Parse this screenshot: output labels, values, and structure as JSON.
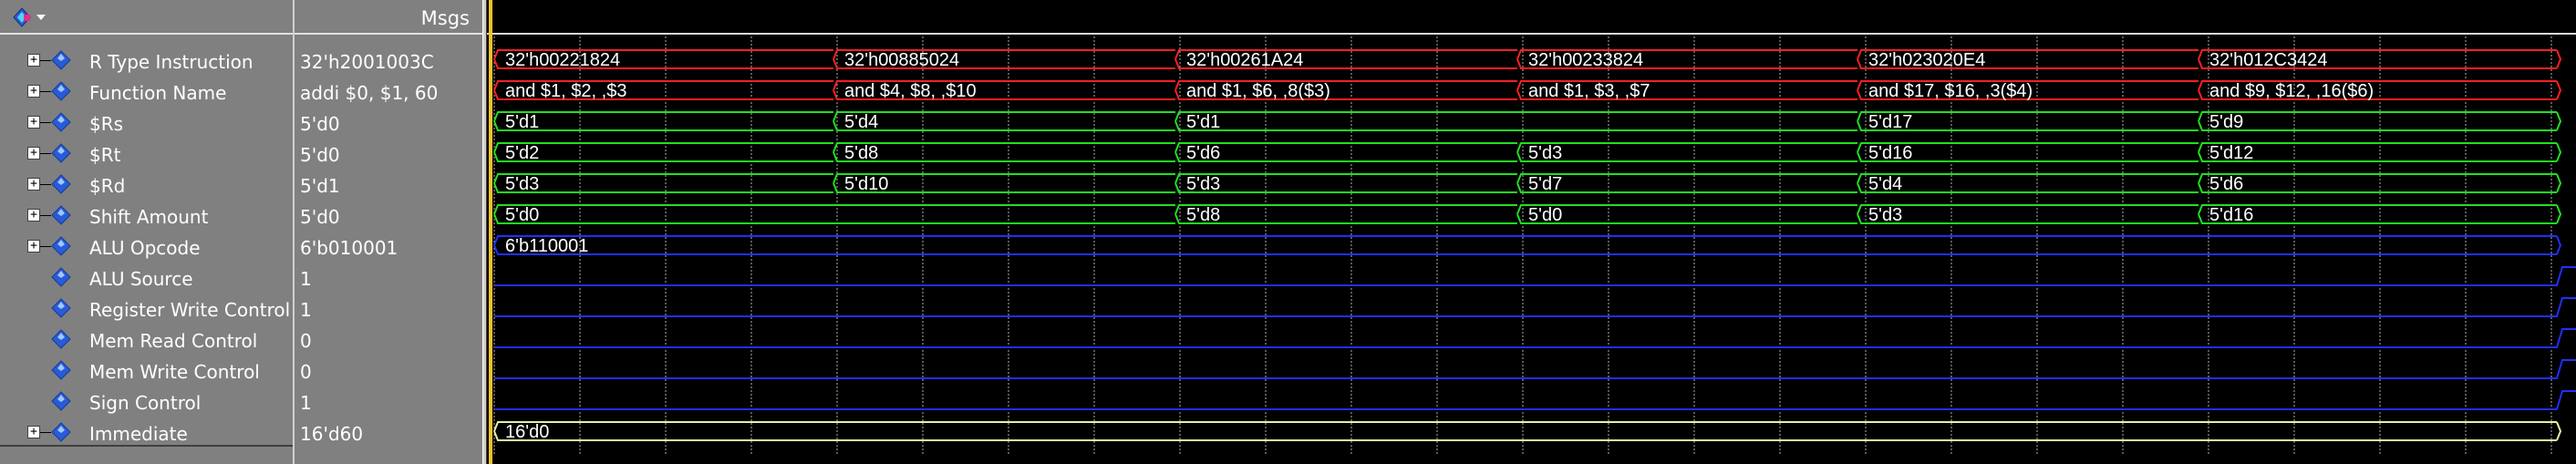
{
  "header": {
    "msgs_label": "Msgs"
  },
  "signals": [
    {
      "name": "R Type Instruction",
      "value": "32'h2001003C",
      "expandable": true
    },
    {
      "name": "Function Name",
      "value": "addi $0, $1, 60",
      "expandable": true
    },
    {
      "name": "$Rs",
      "value": "5'd0",
      "expandable": true
    },
    {
      "name": "$Rt",
      "value": "5'd0",
      "expandable": true
    },
    {
      "name": "$Rd",
      "value": "5'd1",
      "expandable": true
    },
    {
      "name": "Shift Amount",
      "value": "5'd0",
      "expandable": true
    },
    {
      "name": "ALU Opcode",
      "value": "6'b010001",
      "expandable": true
    },
    {
      "name": "ALU Source",
      "value": "1",
      "expandable": false
    },
    {
      "name": "Register Write Control",
      "value": "1",
      "expandable": false
    },
    {
      "name": "Mem Read Control",
      "value": "0",
      "expandable": false
    },
    {
      "name": "Mem Write Control",
      "value": "0",
      "expandable": false
    },
    {
      "name": "Sign Control",
      "value": "1",
      "expandable": false
    },
    {
      "name": "Immediate",
      "value": "16'd60",
      "expandable": true
    }
  ],
  "waveforms": [
    {
      "signal": "R Type Instruction",
      "color": "#ff2020",
      "kind": "bus",
      "segments": [
        "32'h00221824",
        "32'h00885024",
        "32'h00261A24",
        "32'h00233824",
        "32'h023020E4",
        "32'h012C3424"
      ]
    },
    {
      "signal": "Function Name",
      "color": "#ff2020",
      "kind": "bus",
      "segments": [
        "and $1, $2, ,$3",
        "and $4, $8, ,$10",
        "and $1, $6, ,8($3)",
        "and $1, $3, ,$7",
        "and $17, $16, ,3($4)",
        "and $9, $12, ,16($6)"
      ]
    },
    {
      "signal": "$Rs",
      "color": "#20e020",
      "kind": "bus",
      "segments": [
        "5'd1",
        "5'd4",
        "5'd1",
        "",
        "5'd17",
        "5'd9"
      ]
    },
    {
      "signal": "$Rt",
      "color": "#20e020",
      "kind": "bus",
      "segments": [
        "5'd2",
        "5'd8",
        "5'd6",
        "5'd3",
        "5'd16",
        "5'd12"
      ]
    },
    {
      "signal": "$Rd",
      "color": "#20e020",
      "kind": "bus",
      "segments": [
        "5'd3",
        "5'd10",
        "5'd3",
        "5'd7",
        "5'd4",
        "5'd6"
      ]
    },
    {
      "signal": "Shift Amount",
      "color": "#20e020",
      "kind": "bus",
      "segments": [
        "5'd0",
        "",
        "5'd8",
        "5'd0",
        "5'd3",
        "5'd16"
      ]
    },
    {
      "signal": "ALU Opcode",
      "color": "#2030ff",
      "kind": "bus",
      "segments": [
        "6'b110001"
      ]
    },
    {
      "signal": "ALU Source",
      "color": "#2030ff",
      "kind": "bit",
      "level": 0
    },
    {
      "signal": "Register Write Control",
      "color": "#2030ff",
      "kind": "bit",
      "level": 0
    },
    {
      "signal": "Mem Read Control",
      "color": "#2030ff",
      "kind": "bit",
      "level": 0
    },
    {
      "signal": "Mem Write Control",
      "color": "#2030ff",
      "kind": "bit",
      "level": 0
    },
    {
      "signal": "Sign Control",
      "color": "#2030ff",
      "kind": "bit",
      "level": 0
    },
    {
      "signal": "Immediate",
      "color": "#e8f0a0",
      "kind": "bus",
      "segments": [
        "16'd0"
      ]
    }
  ],
  "colors": {
    "wave_bg": "#000000",
    "grid": "#b0b0b0",
    "cursor": "#f2c12e",
    "pane_bg": "#808080",
    "icon_blue": "#2a5bd7"
  }
}
